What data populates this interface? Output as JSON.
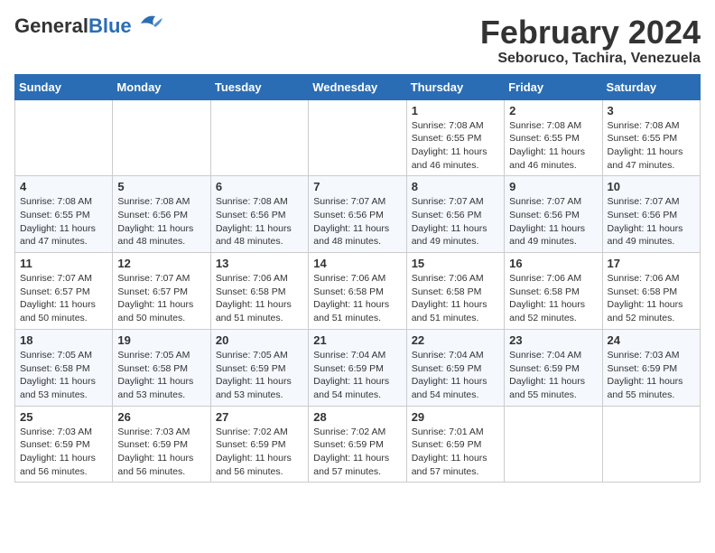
{
  "header": {
    "logo_general": "General",
    "logo_blue": "Blue",
    "main_title": "February 2024",
    "subtitle": "Seboruco, Tachira, Venezuela"
  },
  "days_of_week": [
    "Sunday",
    "Monday",
    "Tuesday",
    "Wednesday",
    "Thursday",
    "Friday",
    "Saturday"
  ],
  "weeks": [
    {
      "days": [
        {
          "number": "",
          "info": ""
        },
        {
          "number": "",
          "info": ""
        },
        {
          "number": "",
          "info": ""
        },
        {
          "number": "",
          "info": ""
        },
        {
          "number": "1",
          "info": "Sunrise: 7:08 AM\nSunset: 6:55 PM\nDaylight: 11 hours\nand 46 minutes."
        },
        {
          "number": "2",
          "info": "Sunrise: 7:08 AM\nSunset: 6:55 PM\nDaylight: 11 hours\nand 46 minutes."
        },
        {
          "number": "3",
          "info": "Sunrise: 7:08 AM\nSunset: 6:55 PM\nDaylight: 11 hours\nand 47 minutes."
        }
      ]
    },
    {
      "days": [
        {
          "number": "4",
          "info": "Sunrise: 7:08 AM\nSunset: 6:55 PM\nDaylight: 11 hours\nand 47 minutes."
        },
        {
          "number": "5",
          "info": "Sunrise: 7:08 AM\nSunset: 6:56 PM\nDaylight: 11 hours\nand 48 minutes."
        },
        {
          "number": "6",
          "info": "Sunrise: 7:08 AM\nSunset: 6:56 PM\nDaylight: 11 hours\nand 48 minutes."
        },
        {
          "number": "7",
          "info": "Sunrise: 7:07 AM\nSunset: 6:56 PM\nDaylight: 11 hours\nand 48 minutes."
        },
        {
          "number": "8",
          "info": "Sunrise: 7:07 AM\nSunset: 6:56 PM\nDaylight: 11 hours\nand 49 minutes."
        },
        {
          "number": "9",
          "info": "Sunrise: 7:07 AM\nSunset: 6:56 PM\nDaylight: 11 hours\nand 49 minutes."
        },
        {
          "number": "10",
          "info": "Sunrise: 7:07 AM\nSunset: 6:56 PM\nDaylight: 11 hours\nand 49 minutes."
        }
      ]
    },
    {
      "days": [
        {
          "number": "11",
          "info": "Sunrise: 7:07 AM\nSunset: 6:57 PM\nDaylight: 11 hours\nand 50 minutes."
        },
        {
          "number": "12",
          "info": "Sunrise: 7:07 AM\nSunset: 6:57 PM\nDaylight: 11 hours\nand 50 minutes."
        },
        {
          "number": "13",
          "info": "Sunrise: 7:06 AM\nSunset: 6:58 PM\nDaylight: 11 hours\nand 51 minutes."
        },
        {
          "number": "14",
          "info": "Sunrise: 7:06 AM\nSunset: 6:58 PM\nDaylight: 11 hours\nand 51 minutes."
        },
        {
          "number": "15",
          "info": "Sunrise: 7:06 AM\nSunset: 6:58 PM\nDaylight: 11 hours\nand 51 minutes."
        },
        {
          "number": "16",
          "info": "Sunrise: 7:06 AM\nSunset: 6:58 PM\nDaylight: 11 hours\nand 52 minutes."
        },
        {
          "number": "17",
          "info": "Sunrise: 7:06 AM\nSunset: 6:58 PM\nDaylight: 11 hours\nand 52 minutes."
        }
      ]
    },
    {
      "days": [
        {
          "number": "18",
          "info": "Sunrise: 7:05 AM\nSunset: 6:58 PM\nDaylight: 11 hours\nand 53 minutes."
        },
        {
          "number": "19",
          "info": "Sunrise: 7:05 AM\nSunset: 6:58 PM\nDaylight: 11 hours\nand 53 minutes."
        },
        {
          "number": "20",
          "info": "Sunrise: 7:05 AM\nSunset: 6:59 PM\nDaylight: 11 hours\nand 53 minutes."
        },
        {
          "number": "21",
          "info": "Sunrise: 7:04 AM\nSunset: 6:59 PM\nDaylight: 11 hours\nand 54 minutes."
        },
        {
          "number": "22",
          "info": "Sunrise: 7:04 AM\nSunset: 6:59 PM\nDaylight: 11 hours\nand 54 minutes."
        },
        {
          "number": "23",
          "info": "Sunrise: 7:04 AM\nSunset: 6:59 PM\nDaylight: 11 hours\nand 55 minutes."
        },
        {
          "number": "24",
          "info": "Sunrise: 7:03 AM\nSunset: 6:59 PM\nDaylight: 11 hours\nand 55 minutes."
        }
      ]
    },
    {
      "days": [
        {
          "number": "25",
          "info": "Sunrise: 7:03 AM\nSunset: 6:59 PM\nDaylight: 11 hours\nand 56 minutes."
        },
        {
          "number": "26",
          "info": "Sunrise: 7:03 AM\nSunset: 6:59 PM\nDaylight: 11 hours\nand 56 minutes."
        },
        {
          "number": "27",
          "info": "Sunrise: 7:02 AM\nSunset: 6:59 PM\nDaylight: 11 hours\nand 56 minutes."
        },
        {
          "number": "28",
          "info": "Sunrise: 7:02 AM\nSunset: 6:59 PM\nDaylight: 11 hours\nand 57 minutes."
        },
        {
          "number": "29",
          "info": "Sunrise: 7:01 AM\nSunset: 6:59 PM\nDaylight: 11 hours\nand 57 minutes."
        },
        {
          "number": "",
          "info": ""
        },
        {
          "number": "",
          "info": ""
        }
      ]
    }
  ]
}
